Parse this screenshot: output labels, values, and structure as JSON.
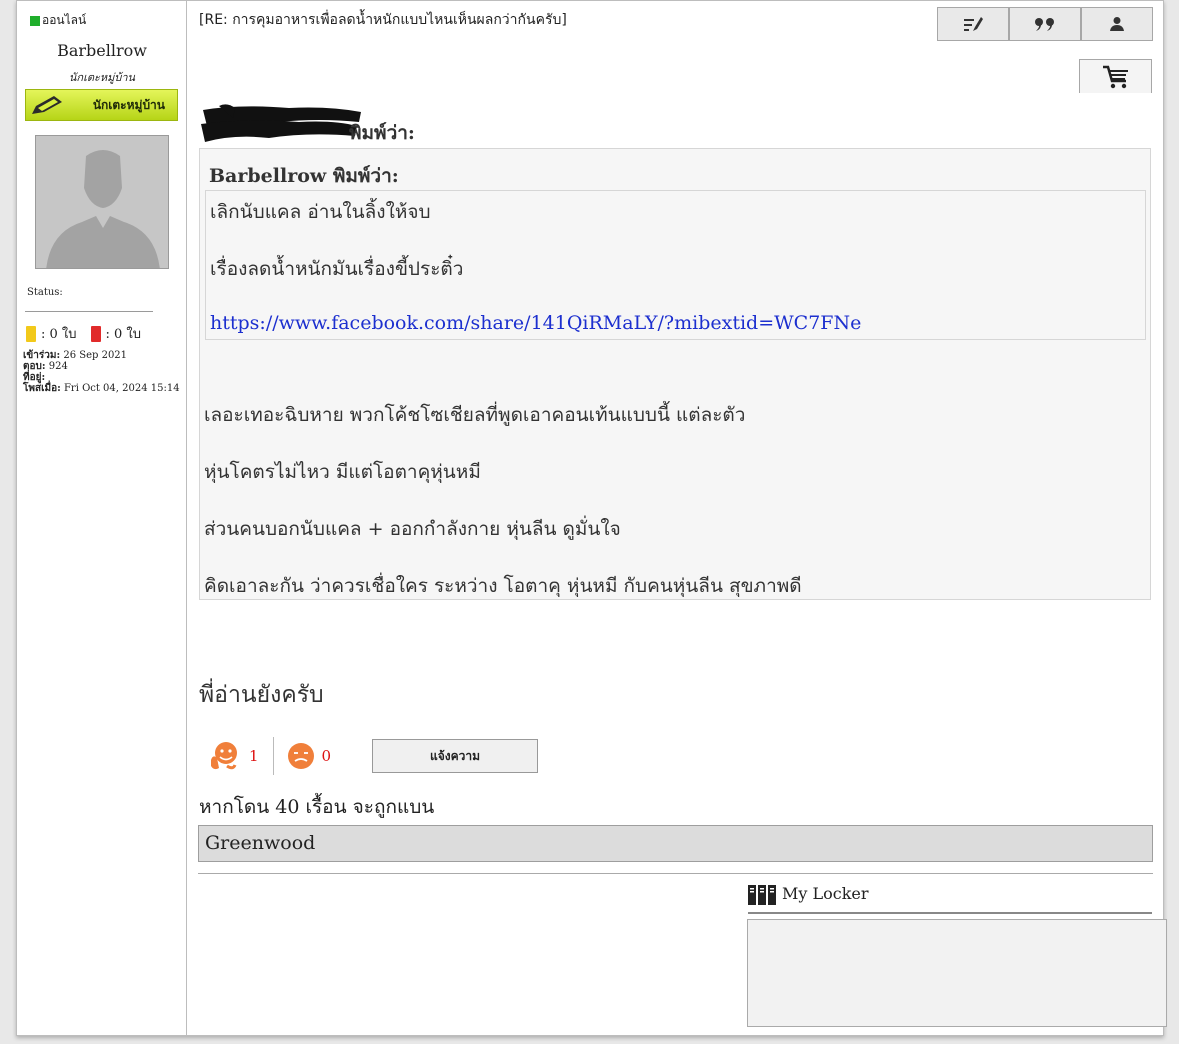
{
  "user": {
    "online_label": "ออนไลน์",
    "name": "Barbellrow",
    "title": "นักเตะหมู่บ้าน",
    "rank_badge": "นักเตะหมู่บ้าน",
    "status_label": "Status:",
    "yellow_cards": ": 0 ใบ",
    "red_cards": ": 0 ใบ",
    "joined_label": "เข้าร่วม:",
    "joined_value": "26 Sep 2021",
    "posts_label": "ตอบ:",
    "posts_value": "924",
    "location_label": "ที่อยู่:",
    "location_value": "",
    "posted_label": "โพสเมื่อ:",
    "posted_value": "Fri Oct 04, 2024 15:14"
  },
  "post": {
    "title": "[RE: การคุมอาหารเพื่อลดน้ำหนักแบบไหนเห็นผลกว่ากันครับ]",
    "outer_quote_suffix": "พิมพ์ว่า:",
    "inner_quote_author": "Barbellrow พิมพ์ว่า:",
    "inner_quote_lines": [
      "เลิกนับแคล อ่านในลิ้งให้จบ",
      "เรื่องลดน้ำหนักมันเรื่องขี้ประติ๋ว"
    ],
    "inner_quote_link": "https://www.facebook.com/share/141QiRMaLY/?mibextid=WC7FNe",
    "outer_quote_lines": [
      "เลอะเทอะฉิบหาย พวกโค้ชโซเชียลที่พูดเอาคอนเท้นแบบนี้ แต่ละตัว",
      "หุ่นโคตรไม่ไหว มีแต่โอตาคุหุ่นหมี",
      "ส่วนคนบอกนับแคล + ออกกำลังกาย หุ่นลีน ดูมั่นใจ",
      "คิดเอาละกัน ว่าควรเชื่อใคร ระหว่าง โอตาคุ หุ่นหมี กับคนหุ่นลีน สุขภาพดี"
    ],
    "reply_text": "พี่อ่านยังครับ",
    "like_count": "1",
    "dislike_count": "0",
    "report_label": "แจ้งความ",
    "ban_notice": "หากโดน 40 เรื้อน จะถูกแบน",
    "signature": "Greenwood",
    "locker_label": "My Locker"
  },
  "icons": {
    "toolbar": [
      "edit-icon",
      "quote-icon",
      "profile-icon"
    ],
    "cart": "cart-icon"
  },
  "colors": {
    "online": "#1fae2b",
    "link": "#1c2fcf",
    "count": "#d11111",
    "badge": "#c8e030"
  }
}
